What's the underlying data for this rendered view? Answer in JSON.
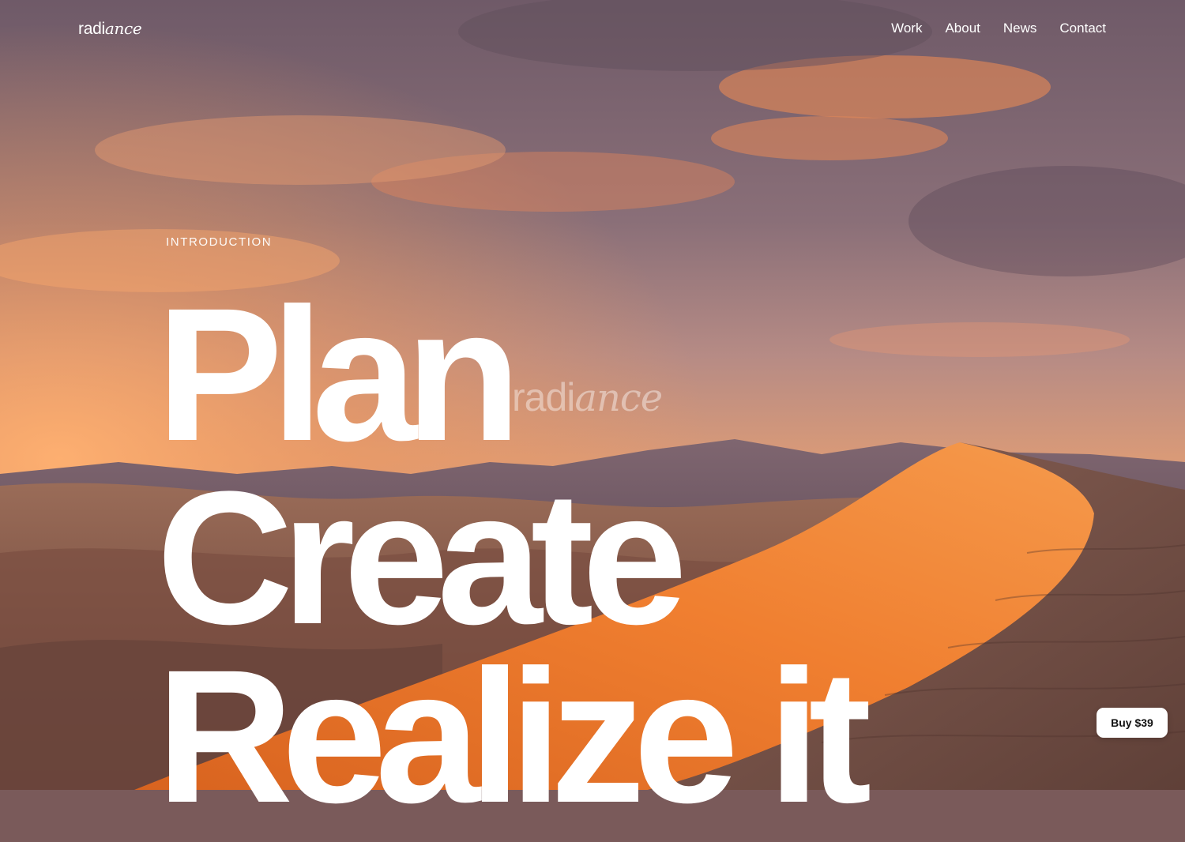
{
  "brand": {
    "logo_regular": "radi",
    "logo_italic": "ance"
  },
  "nav": {
    "items": [
      {
        "label": "Work"
      },
      {
        "label": "About"
      },
      {
        "label": "News"
      },
      {
        "label": "Contact"
      }
    ]
  },
  "hero": {
    "eyebrow": "INTRODUCTION",
    "lines": [
      "Plan",
      "Create",
      "Realize it"
    ],
    "watermark_regular": "radi",
    "watermark_italic": "ance"
  },
  "cta": {
    "buy_label": "Buy $39"
  },
  "background": {
    "description_icon": "desert-dunes-sunset-image",
    "colors": {
      "sky_top": "#7d6570",
      "sky_glow": "#f39a5c",
      "dune_orange": "#ef7a2c",
      "dune_shadow": "#6a4a40"
    }
  }
}
